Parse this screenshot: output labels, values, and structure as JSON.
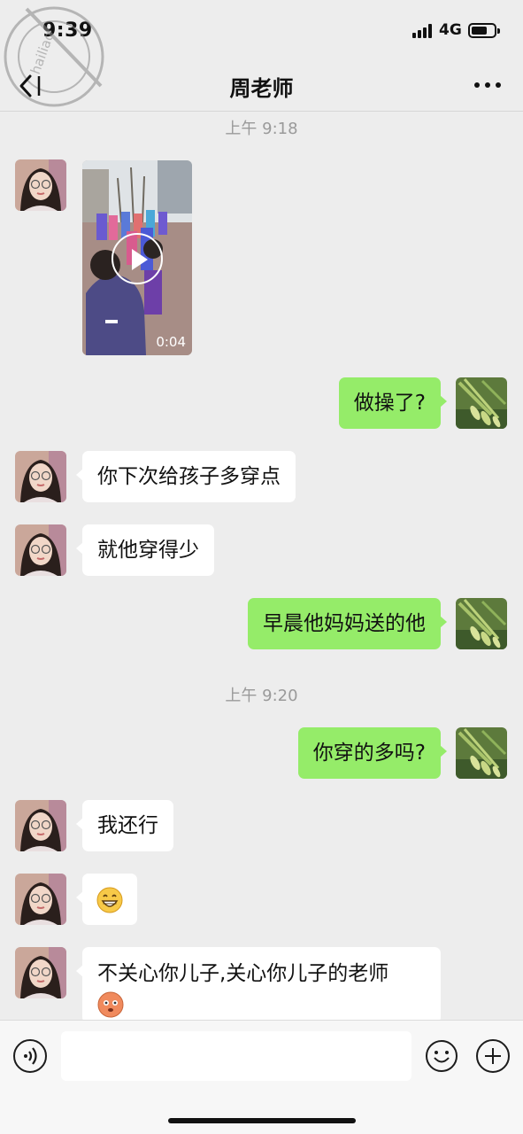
{
  "status_bar": {
    "time": "9:39",
    "network": "4G",
    "battery_level": 0.6
  },
  "watermark": {
    "text": "hailiao 抖音"
  },
  "nav": {
    "title": "周老师",
    "back_icon": "chevron-left-icon",
    "more_icon": "more-dots-icon"
  },
  "chat": {
    "timestamps": [
      "上午 9:18",
      "上午 9:20"
    ],
    "video": {
      "duration": "0:04"
    },
    "messages": [
      {
        "from": "me",
        "text": "做操了?"
      },
      {
        "from": "teacher",
        "text": "你下次给孩子多穿点"
      },
      {
        "from": "teacher",
        "text": "就他穿得少"
      },
      {
        "from": "me",
        "text": "早晨他妈妈送的他"
      },
      {
        "from": "me",
        "text": "你穿的多吗?"
      },
      {
        "from": "teacher",
        "text": "我还行"
      },
      {
        "from": "teacher",
        "emoji": "grin-emoji"
      },
      {
        "from": "teacher",
        "text": "不关心你儿子,关心你儿子的老师",
        "emoji": "blush-emoji"
      }
    ]
  },
  "input_bar": {
    "voice_icon": "voice-icon",
    "emoji_icon": "smile-icon",
    "plus_icon": "plus-icon",
    "value": ""
  },
  "colors": {
    "sent_bubble": "#95ec69",
    "received_bubble": "#ffffff",
    "background": "#ededed"
  }
}
